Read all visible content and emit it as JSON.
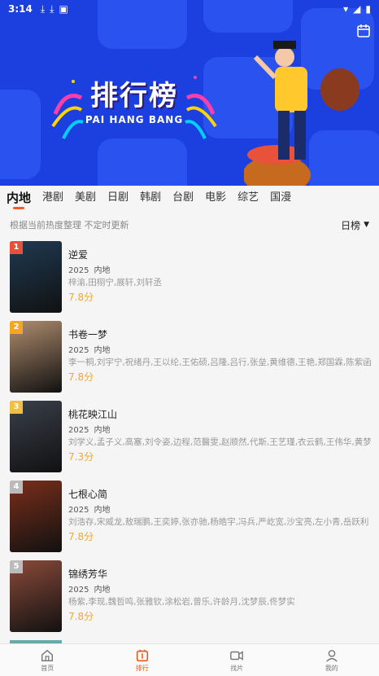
{
  "status_bar": {
    "time": "3:14"
  },
  "hero": {
    "title": "排行榜",
    "subtitle": "PAI HANG BANG"
  },
  "tabs": [
    {
      "label": "内地",
      "active": true
    },
    {
      "label": "港剧",
      "active": false
    },
    {
      "label": "美剧",
      "active": false
    },
    {
      "label": "日剧",
      "active": false
    },
    {
      "label": "韩剧",
      "active": false
    },
    {
      "label": "台剧",
      "active": false
    },
    {
      "label": "电影",
      "active": false
    },
    {
      "label": "综艺",
      "active": false
    },
    {
      "label": "国漫",
      "active": false
    }
  ],
  "note": "根据当前热度整理 不定时更新",
  "rank_select": {
    "label": "日榜"
  },
  "items": [
    {
      "rank": "1",
      "name": "逆爱",
      "year": "2025",
      "region": "内地",
      "cast": "梓渝,田栩宁,展轩,刘轩丞",
      "score": "7.8分",
      "badge_color": "#e8503a",
      "poster_color": "#1f3a52"
    },
    {
      "rank": "2",
      "name": "书卷一梦",
      "year": "2025",
      "region": "内地",
      "cast": "李一桐,刘宇宁,祝绪丹,王以纶,王佑硕,吕隆,吕行,张垒,黄维德,王艳,郑国霖,陈紫函,",
      "score": "7.8分",
      "badge_color": "#f5a623",
      "poster_color": "#b08d6e"
    },
    {
      "rank": "3",
      "name": "桃花映江山",
      "year": "2025",
      "region": "内地",
      "cast": "刘学义,孟子义,高塞,刘令姿,边程,范醫雯,赵顺然,代斯,王艺瑾,衣云鹤,王伟华,黄梦莹",
      "score": "7.3分",
      "badge_color": "#f0c040",
      "poster_color": "#3a3f4a"
    },
    {
      "rank": "4",
      "name": "七根心简",
      "year": "2025",
      "region": "内地",
      "cast": "刘浩存,宋威龙,敖瑞鹏,王奕婷,张亦驰,杨皓宇,冯兵,严屹宽,沙宝亮,左小青,岳跃利",
      "score": "7.8分",
      "badge_color": "#bbbbbb",
      "poster_color": "#7a2e1a"
    },
    {
      "rank": "5",
      "name": "锦绣芳华",
      "year": "2025",
      "region": "内地",
      "cast": "杨紫,李现,魏哲鸣,张雅钦,涂松岩,曾乐,许龄月,沈梦辰,佟梦实",
      "score": "7.8分",
      "badge_color": "#bbbbbb",
      "poster_color": "#8a4a3a"
    }
  ],
  "bottom_nav": [
    {
      "label": "首页",
      "icon": "home-icon",
      "active": false
    },
    {
      "label": "排行",
      "icon": "ranking-icon",
      "active": true
    },
    {
      "label": "找片",
      "icon": "video-icon",
      "active": false
    },
    {
      "label": "我的",
      "icon": "user-icon",
      "active": false
    }
  ]
}
